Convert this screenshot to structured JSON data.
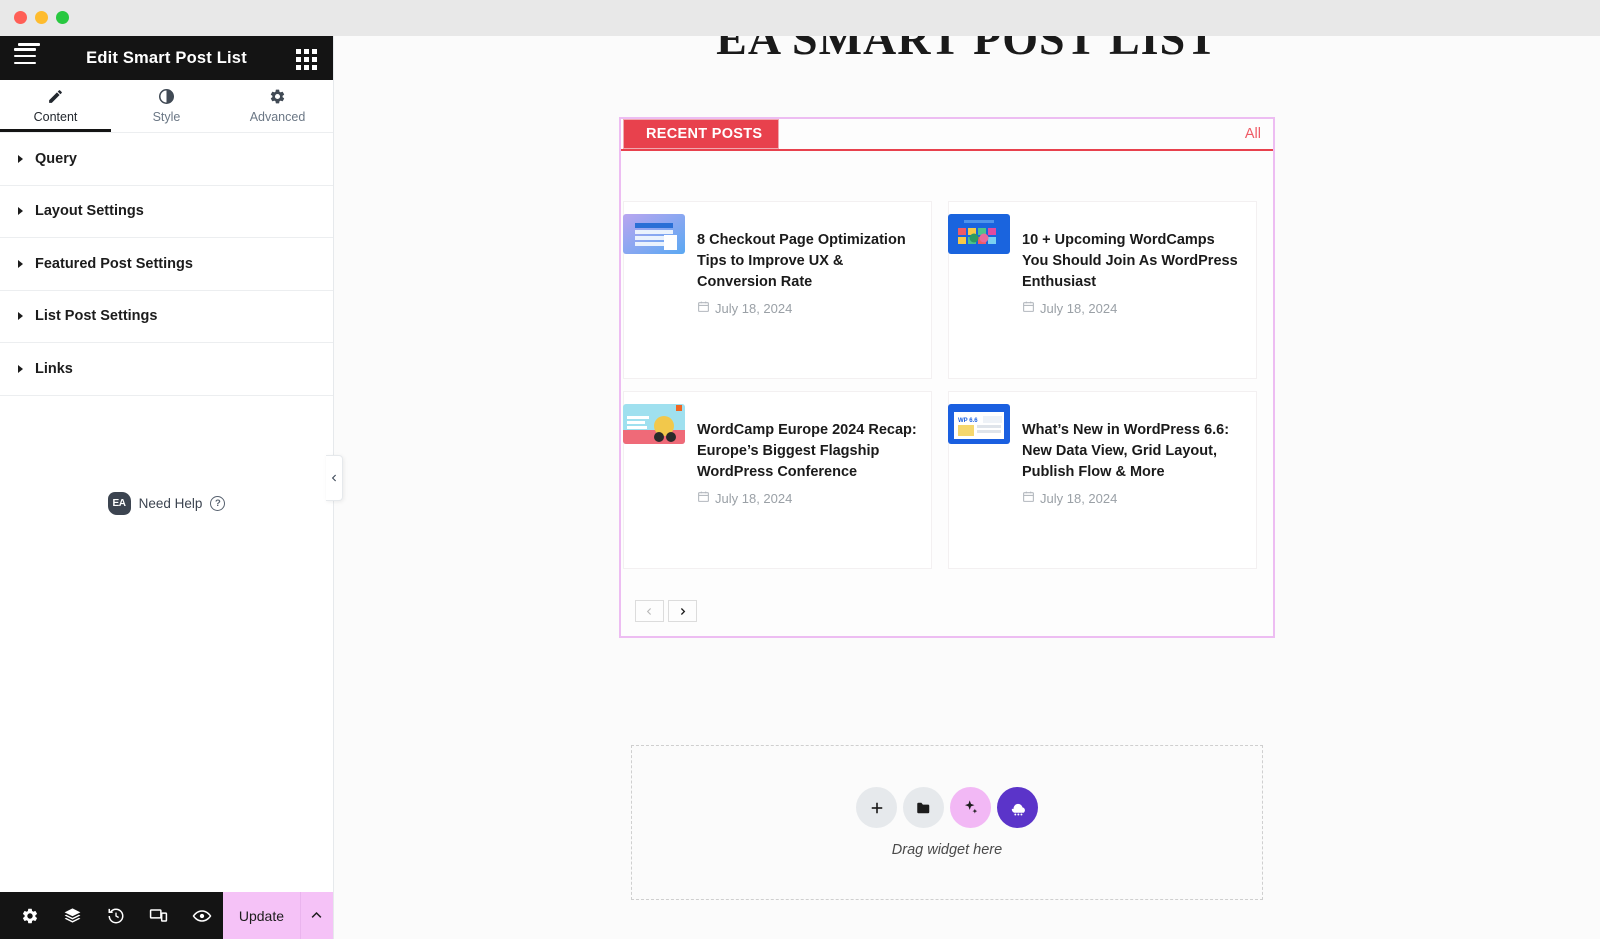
{
  "window": {
    "traffic_lights": [
      "close",
      "minimize",
      "maximize"
    ]
  },
  "panel": {
    "header": {
      "title": "Edit Smart Post List",
      "menu_icon": "hamburger-icon",
      "notification_dot": true,
      "apps_icon": "apps-grid-icon"
    },
    "tabs": [
      {
        "label": "Content",
        "icon": "pencil-icon",
        "active": true
      },
      {
        "label": "Style",
        "icon": "contrast-icon",
        "active": false
      },
      {
        "label": "Advanced",
        "icon": "gear-icon",
        "active": false
      }
    ],
    "sections": [
      {
        "label": "Query"
      },
      {
        "label": "Layout Settings"
      },
      {
        "label": "Featured Post Settings"
      },
      {
        "label": "List Post Settings"
      },
      {
        "label": "Links"
      }
    ],
    "need_help": {
      "badge": "EA",
      "label": "Need Help",
      "help_icon": "question-mark-icon"
    },
    "footer": {
      "icons": [
        "settings-gear-icon",
        "navigator-layers-icon",
        "history-icon",
        "responsive-mode-icon",
        "preview-eye-icon"
      ],
      "update_label": "Update",
      "update_caret_icon": "chevron-up-icon"
    },
    "collapse_handle_icon": "chevron-left-icon"
  },
  "canvas": {
    "page_heading": "EA SMART POST LIST",
    "widget": {
      "category_tab": "RECENT POSTS",
      "all_link": "All",
      "accent_color": "#e8414d",
      "border_color": "#edbdf2",
      "posts": [
        {
          "title": "8 Checkout Page Optimization Tips to Improve UX & Conversion Rate",
          "date": "July 18, 2024",
          "date_icon": "calendar-icon",
          "thumb": "checkout-page-thumbnail"
        },
        {
          "title": "10 + Upcoming WordCamps You Should Join As WordPress Enthusiast",
          "date": "July 18, 2024",
          "date_icon": "calendar-icon",
          "thumb": "wordcamps-thumbnail"
        },
        {
          "title": "WordCamp Europe 2024 Recap: Europe’s Biggest Flagship WordPress Conference",
          "date": "July 18, 2024",
          "date_icon": "calendar-icon",
          "thumb": "wceu-recap-thumbnail"
        },
        {
          "title": "What’s New in WordPress 6.6: New Data View, Grid Layout, Publish Flow & More",
          "date": "July 18, 2024",
          "date_icon": "calendar-icon",
          "thumb": "wordpress-66-thumbnail"
        }
      ],
      "pagination": {
        "prev_icon": "chevron-left-icon",
        "next_icon": "chevron-right-icon",
        "prev_disabled": true
      }
    },
    "dropzone": {
      "label": "Drag widget here",
      "buttons": [
        {
          "icon": "plus-icon",
          "style": "grey"
        },
        {
          "icon": "folder-icon",
          "style": "grey"
        },
        {
          "icon": "ai-sparkle-icon",
          "style": "pink"
        },
        {
          "icon": "elementor-cloud-icon",
          "style": "purple"
        }
      ]
    }
  }
}
